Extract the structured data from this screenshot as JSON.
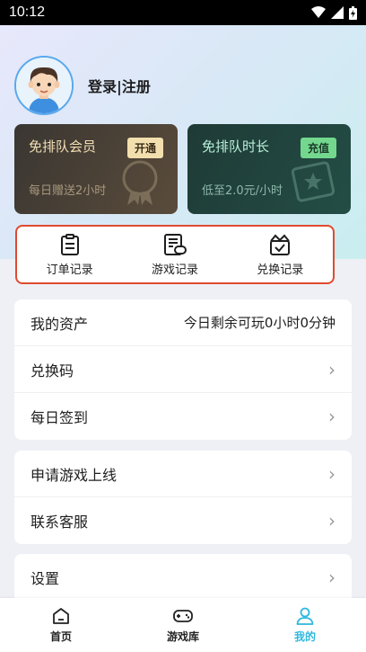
{
  "status_bar": {
    "time": "10:12"
  },
  "profile": {
    "login_label": "登录|注册"
  },
  "cards": [
    {
      "title": "免排队会员",
      "button": "开通",
      "subtitle": "每日赠送2小时"
    },
    {
      "title": "免排队时长",
      "button": "充值",
      "subtitle": "低至2.0元/小时"
    }
  ],
  "quick_actions": [
    {
      "label": "订单记录",
      "icon": "clipboard-icon"
    },
    {
      "label": "游戏记录",
      "icon": "game-record-icon"
    },
    {
      "label": "兑换记录",
      "icon": "gift-box-icon"
    }
  ],
  "section1": {
    "assets_label": "我的资产",
    "assets_value": "今日剩余可玩0小时0分钟",
    "redeem_label": "兑换码",
    "checkin_label": "每日签到"
  },
  "section2": {
    "apply_label": "申请游戏上线",
    "support_label": "联系客服"
  },
  "section3": {
    "settings_label": "设置"
  },
  "bottom_nav": [
    {
      "label": "首页",
      "icon": "home-icon",
      "active": false
    },
    {
      "label": "游戏库",
      "icon": "gamepad-icon",
      "active": false
    },
    {
      "label": "我的",
      "icon": "user-icon",
      "active": true
    }
  ],
  "colors": {
    "accent": "#2fb8dd",
    "highlight_border": "#e04a2f"
  }
}
